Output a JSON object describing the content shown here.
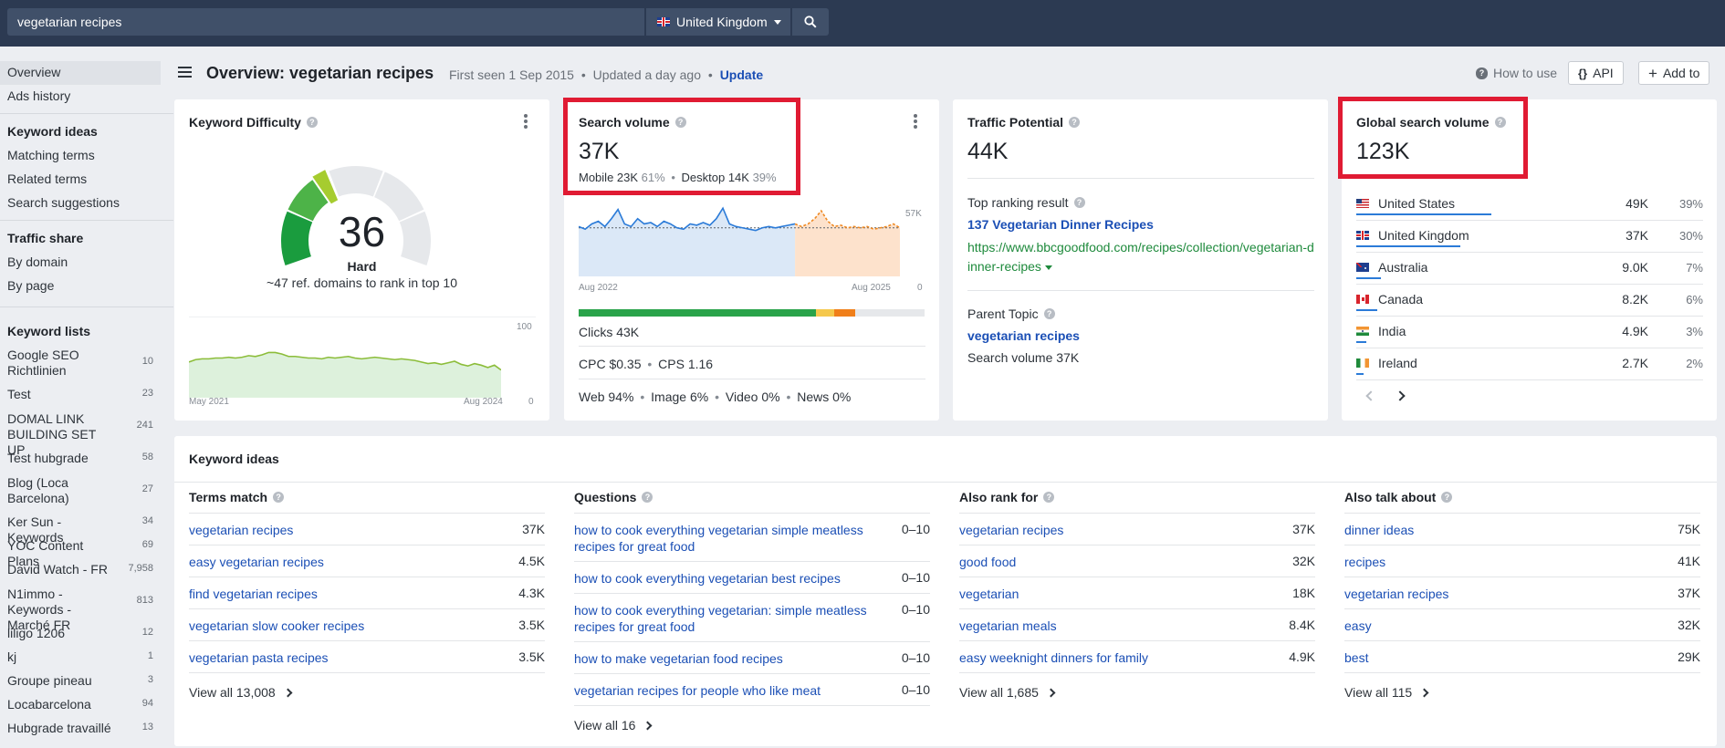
{
  "search": {
    "value": "vegetarian recipes",
    "country": "United Kingdom"
  },
  "sidebar": {
    "items_top": [
      "Overview",
      "Ads history"
    ],
    "keyword_ideas_heading": "Keyword ideas",
    "keyword_ideas_items": [
      "Matching terms",
      "Related terms",
      "Search suggestions"
    ],
    "traffic_share_heading": "Traffic share",
    "traffic_share_items": [
      "By domain",
      "By page"
    ],
    "keyword_lists_heading": "Keyword lists",
    "keyword_lists": [
      {
        "name": "Google SEO Richtlinien",
        "count": "10"
      },
      {
        "name": "Test",
        "count": "23"
      },
      {
        "name": "DOMAL LINK BUILDING SET UP",
        "count": "241"
      },
      {
        "name": "Test hubgrade",
        "count": "58"
      },
      {
        "name": "Blog (Loca Barcelona)",
        "count": "27"
      },
      {
        "name": "Ker Sun - Keywords",
        "count": "34"
      },
      {
        "name": "YOC Content Plans",
        "count": "69"
      },
      {
        "name": "David Watch - FR",
        "count": "7,958"
      },
      {
        "name": "N1immo - Keywords - Marché FR",
        "count": "813"
      },
      {
        "name": "liligo 1206",
        "count": "12"
      },
      {
        "name": "kj",
        "count": "1"
      },
      {
        "name": "Groupe pineau",
        "count": "3"
      },
      {
        "name": "Locabarcelona",
        "count": "94"
      },
      {
        "name": "Hubgrade travaillé",
        "count": "13"
      }
    ]
  },
  "header": {
    "title": "Overview: vegetarian recipes",
    "first_seen": "First seen 1 Sep 2015",
    "updated": "Updated a day ago",
    "dot": "•",
    "update_link": "Update",
    "how_to_use": "How to use",
    "api_label": "API",
    "add_to_label": "Add to"
  },
  "kd_card": {
    "title": "Keyword Difficulty",
    "score": "36",
    "score_value": 36,
    "level": "Hard",
    "note": "~47 ref. domains to rank in top 10",
    "chart_ymax": "100",
    "chart_ymin": "0",
    "chart_start": "May 2021",
    "chart_end": "Aug 2024",
    "colors": {
      "line": "#8cbd3a",
      "fill": "#d7efd6"
    }
  },
  "sv_card": {
    "title": "Search volume",
    "value": "37K",
    "mobile_label": "Mobile 23K",
    "mobile_pct": "61%",
    "desktop_label": "Desktop 14K",
    "desktop_pct": "39%",
    "dot": "•",
    "chart_ymax": "57K",
    "chart_ymin": "0",
    "chart_start": "Aug 2022",
    "chart_end": "Aug 2025",
    "intent_bar": [
      {
        "name": "green",
        "fraction": 0.685,
        "color": "#2aa34a"
      },
      {
        "name": "yellow",
        "fraction": 0.055,
        "color": "#f5c84c"
      },
      {
        "name": "orange",
        "fraction": 0.06,
        "color": "#f07f1a"
      },
      {
        "name": "rest",
        "fraction": 0.2,
        "color": "#e6e8eb"
      }
    ],
    "clicks": "Clicks 43K",
    "cpc": "CPC $0.35",
    "cps": "CPS 1.16",
    "serp_mix": [
      "Web 94%",
      "Image 6%",
      "Video 0%",
      "News 0%"
    ]
  },
  "tp_card": {
    "title": "Traffic Potential",
    "value": "44K",
    "top_ranking_label": "Top ranking result",
    "top_result_title": "137 Vegetarian Dinner Recipes",
    "top_result_url": "https://www.bbcgoodfood.com/recipes/collection/vegetarian-dinner-recipes",
    "parent_topic_label": "Parent Topic",
    "parent_topic": "vegetarian recipes",
    "parent_sv": "Search volume 37K"
  },
  "gsv_card": {
    "title": "Global search volume",
    "value": "123K",
    "countries": [
      {
        "name": "United States",
        "value": "49K",
        "pct": "39%",
        "share": 0.39,
        "flag": "flag-us"
      },
      {
        "name": "United Kingdom",
        "value": "37K",
        "pct": "30%",
        "share": 0.3,
        "flag": "flag-uk"
      },
      {
        "name": "Australia",
        "value": "9.0K",
        "pct": "7%",
        "share": 0.07,
        "flag": "flag-au"
      },
      {
        "name": "Canada",
        "value": "8.2K",
        "pct": "6%",
        "share": 0.06,
        "flag": "flag-ca"
      },
      {
        "name": "India",
        "value": "4.9K",
        "pct": "3%",
        "share": 0.03,
        "flag": "flag-in"
      },
      {
        "name": "Ireland",
        "value": "2.7K",
        "pct": "2%",
        "share": 0.02,
        "flag": "flag-ie"
      }
    ]
  },
  "keyword_ideas": {
    "title": "Keyword ideas",
    "columns": [
      {
        "title": "Terms match",
        "view_all": "View all 13,008",
        "rows": [
          {
            "keyword": "vegetarian recipes",
            "value": "37K"
          },
          {
            "keyword": "easy vegetarian recipes",
            "value": "4.5K"
          },
          {
            "keyword": "find vegetarian recipes",
            "value": "4.3K"
          },
          {
            "keyword": "vegetarian slow cooker recipes",
            "value": "3.5K"
          },
          {
            "keyword": "vegetarian pasta recipes",
            "value": "3.5K"
          }
        ]
      },
      {
        "title": "Questions",
        "view_all": "View all 16",
        "rows": [
          {
            "keyword": "how to cook everything vegetarian simple meatless recipes for great food",
            "value": "0–10"
          },
          {
            "keyword": "how to cook everything vegetarian best recipes",
            "value": "0–10"
          },
          {
            "keyword": "how to cook everything vegetarian: simple meatless recipes for great food",
            "value": "0–10"
          },
          {
            "keyword": "how to make vegetarian food recipes",
            "value": "0–10"
          },
          {
            "keyword": "vegetarian recipes for people who like meat",
            "value": "0–10"
          }
        ]
      },
      {
        "title": "Also rank for",
        "view_all": "View all 1,685",
        "rows": [
          {
            "keyword": "vegetarian recipes",
            "value": "37K"
          },
          {
            "keyword": "good food",
            "value": "32K"
          },
          {
            "keyword": "vegetarian",
            "value": "18K"
          },
          {
            "keyword": "vegetarian meals",
            "value": "8.4K"
          },
          {
            "keyword": "easy weeknight dinners for family",
            "value": "4.9K"
          }
        ]
      },
      {
        "title": "Also talk about",
        "view_all": "View all 115",
        "rows": [
          {
            "keyword": "dinner ideas",
            "value": "75K"
          },
          {
            "keyword": "recipes",
            "value": "41K"
          },
          {
            "keyword": "vegetarian recipes",
            "value": "37K"
          },
          {
            "keyword": "easy",
            "value": "32K"
          },
          {
            "keyword": "best",
            "value": "29K"
          }
        ]
      }
    ]
  },
  "colors": {
    "accent": "#1b4fb5",
    "highlight": "#e01b33",
    "url_green": "#1e8a3c",
    "topbar": "#2c3a52"
  }
}
